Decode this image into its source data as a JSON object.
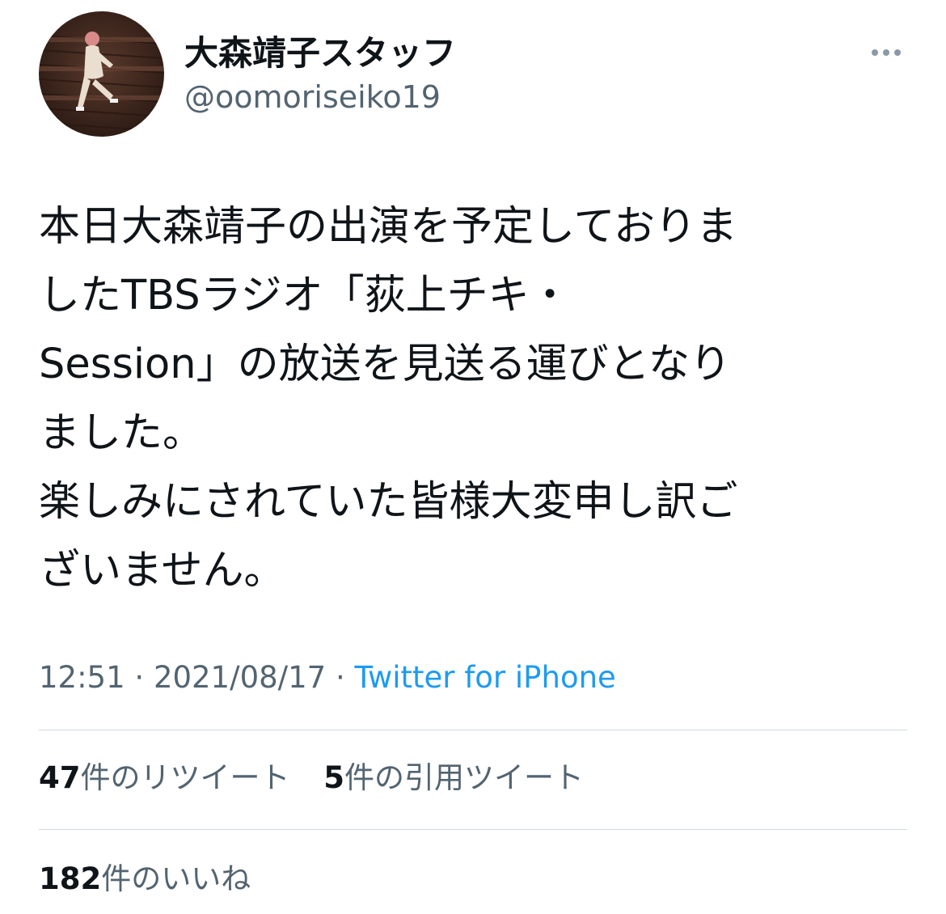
{
  "author": {
    "display_name": "大森靖子スタッフ",
    "handle": "@oomoriseiko19",
    "avatar_icon": "user-avatar-photo"
  },
  "more_icon": "more-horizontal-icon",
  "tweet": {
    "lines": [
      "本日大森靖子の出演を予定しておりま",
      "したTBSラジオ「荻上チキ・",
      "Session」の放送を見送る運びとなり",
      "ました。",
      "楽しみにされていた皆様大変申し訳ご",
      "ざいません。"
    ]
  },
  "meta": {
    "time": "12:51",
    "separator": "·",
    "date": "2021/08/17",
    "source": "Twitter for iPhone"
  },
  "stats": {
    "retweets_count": "47",
    "retweets_label": "件のリツイート",
    "quotes_count": "5",
    "quotes_label": "件の引用ツイート",
    "likes_count": "182",
    "likes_label": "件のいいね"
  },
  "colors": {
    "text": "#0f1419",
    "secondary": "#536471",
    "link": "#1d9bf0",
    "divider": "#cfd9de"
  }
}
